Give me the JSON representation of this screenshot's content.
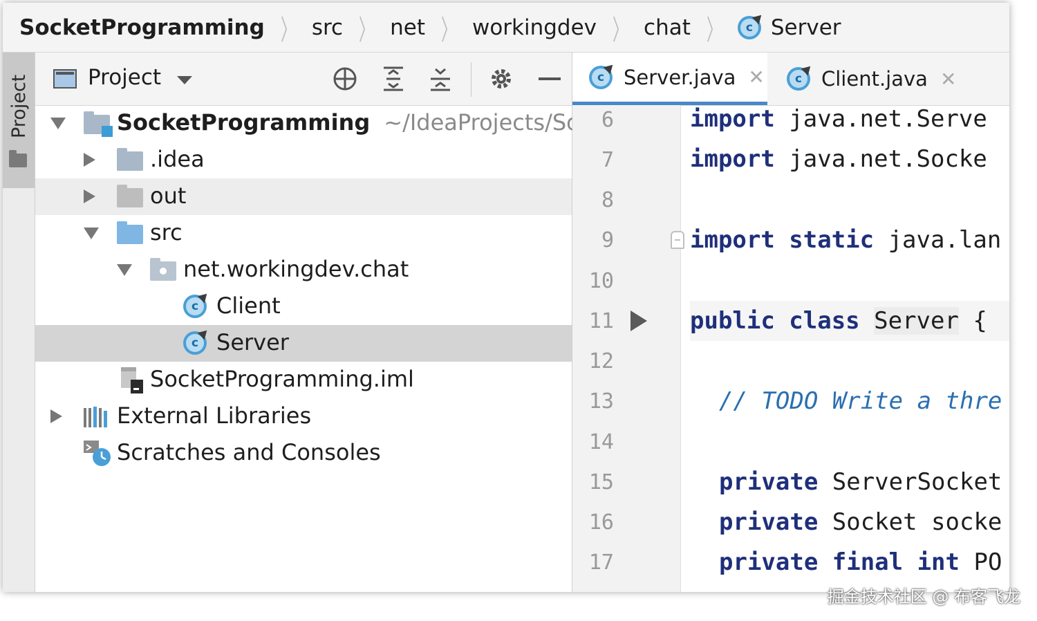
{
  "breadcrumb": {
    "items": [
      "SocketProgramming",
      "src",
      "net",
      "workingdev",
      "chat",
      "Server"
    ]
  },
  "tool_strip": {
    "label": "Project"
  },
  "project_panel": {
    "title": "Project",
    "tree": [
      {
        "label": "SocketProgramming",
        "path": "~/IdeaProjects/So",
        "icon": "project-folder-icon",
        "expanded": true
      },
      {
        "label": ".idea",
        "icon": "folder-icon",
        "expanded": false
      },
      {
        "label": "out",
        "icon": "folder-icon",
        "expanded": false
      },
      {
        "label": "src",
        "icon": "source-folder-icon",
        "expanded": true
      },
      {
        "label": "net.workingdev.chat",
        "icon": "package-icon",
        "expanded": true
      },
      {
        "label": "Client",
        "icon": "class-icon"
      },
      {
        "label": "Server",
        "icon": "class-icon",
        "selected": true
      },
      {
        "label": "SocketProgramming.iml",
        "icon": "module-file-icon"
      },
      {
        "label": "External Libraries",
        "icon": "libraries-icon",
        "expanded": false
      },
      {
        "label": "Scratches and Consoles",
        "icon": "scratches-icon"
      }
    ]
  },
  "editor": {
    "tabs": [
      {
        "label": "Server.java",
        "active": true
      },
      {
        "label": "Client.java",
        "active": false
      }
    ],
    "line_numbers": [
      "6",
      "7",
      "8",
      "9",
      "10",
      "11",
      "12",
      "13",
      "14",
      "15",
      "16",
      "17"
    ],
    "code": {
      "l6_kw": "import",
      "l6_rest": " java.net.Serve",
      "l7_kw": "import",
      "l7_rest": " java.net.Socke",
      "l9_kw": "import static",
      "l9_rest": " java.lan",
      "l11_kw": "public class",
      "l11_id": "Server",
      "l11_rest": " {",
      "l13_comment": "// TODO Write a thre",
      "l15_kw": "private",
      "l15_rest": " ServerSocket",
      "l16_kw": "private",
      "l16_rest": " Socket socke",
      "l17_kw": "private final int",
      "l17_rest": " PO"
    }
  },
  "watermark": "掘金技术社区 @ 布客飞龙",
  "colors": {
    "accent": "#4a88c7",
    "keyword": "#1f2f7a",
    "comment": "#2a6fb0",
    "selection": "#d4d4d4"
  }
}
